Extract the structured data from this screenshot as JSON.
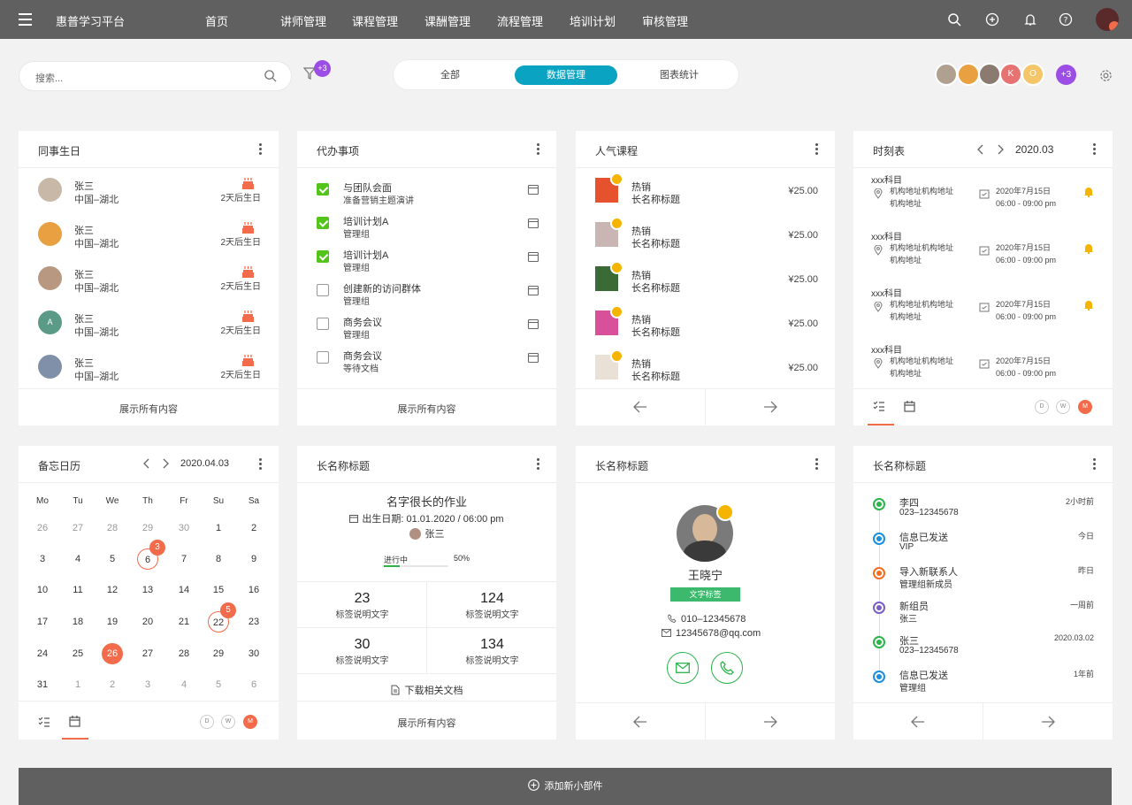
{
  "topbar": {
    "brand": "惠普学习平台",
    "nav": [
      "首页",
      "讲师管理",
      "课程管理",
      "课酬管理",
      "流程管理",
      "培训计划",
      "审核管理"
    ]
  },
  "toolbar": {
    "search_placeholder": "搜索...",
    "filter_badge": "+3",
    "tabs": [
      "全部",
      "数据管理",
      "图表统计"
    ],
    "active_tab": "数据管理",
    "avatars": [
      "K",
      "O"
    ],
    "avatars_more": "+3"
  },
  "birthdays": {
    "title": "同事生日",
    "items": [
      {
        "name": "张三",
        "region": "中国–湖北",
        "note": "2天后生日"
      },
      {
        "name": "张三",
        "region": "中国–湖北",
        "note": "2天后生日"
      },
      {
        "name": "张三",
        "region": "中国–湖北",
        "note": "2天后生日"
      },
      {
        "name": "张三",
        "region": "中国–湖北",
        "note": "2天后生日",
        "initial": "A"
      },
      {
        "name": "张三",
        "region": "中国–湖北",
        "note": "2天后生日"
      }
    ],
    "footer": "展示所有内容"
  },
  "todos": {
    "title": "代办事项",
    "items": [
      {
        "title": "与团队会面",
        "sub": "准备营销主题演讲",
        "checked": true,
        "icon": "calendar-check-icon"
      },
      {
        "title": "培训计划A",
        "sub": "管理组",
        "checked": true,
        "icon": "plane-icon"
      },
      {
        "title": "培训计划A",
        "sub": "管理组",
        "checked": true,
        "icon": "ticket-icon"
      },
      {
        "title": "创建新的访问群体",
        "sub": "管理组",
        "checked": false,
        "icon": "megaphone-icon"
      },
      {
        "title": "商务会议",
        "sub": "管理组",
        "checked": false,
        "icon": "briefcase-icon"
      },
      {
        "title": "商务会议",
        "sub": "等待文档",
        "checked": false,
        "icon": "coins-icon"
      }
    ],
    "footer": "展示所有内容"
  },
  "courses": {
    "title": "人气课程",
    "items": [
      {
        "tag": "热销",
        "name": "长名称标题",
        "price": "¥25.00"
      },
      {
        "tag": "热销",
        "name": "长名称标题",
        "price": "¥25.00"
      },
      {
        "tag": "热销",
        "name": "长名称标题",
        "price": "¥25.00"
      },
      {
        "tag": "热销",
        "name": "长名称标题",
        "price": "¥25.00"
      },
      {
        "tag": "热销",
        "name": "长名称标题",
        "price": "¥25.00"
      }
    ]
  },
  "schedule": {
    "title": "时刻表",
    "date": "2020.03",
    "items": [
      {
        "subject": "xxx科目",
        "addr1": "机构地址机构地址",
        "addr2": "机构地址",
        "date": "2020年7月15日",
        "time": "06:00 - 09:00 pm",
        "bell": true
      },
      {
        "subject": "xxx科目",
        "addr1": "机构地址机构地址",
        "addr2": "机构地址",
        "date": "2020年7月15日",
        "time": "06:00 - 09:00 pm",
        "bell": true
      },
      {
        "subject": "xxx科目",
        "addr1": "机构地址机构地址",
        "addr2": "机构地址",
        "date": "2020年7月15日",
        "time": "06:00 - 09:00 pm",
        "bell": true
      },
      {
        "subject": "xxx科目",
        "addr1": "机构地址机构地址",
        "addr2": "机构地址",
        "date": "2020年7月15日",
        "time": "06:00 - 09:00 pm",
        "bell": false
      }
    ],
    "views": [
      "D",
      "W",
      "M"
    ],
    "active_view": "M"
  },
  "calendar": {
    "title": "备忘日历",
    "date": "2020.04.03",
    "weekdays": [
      "Mo",
      "Tu",
      "We",
      "Th",
      "Fr",
      "Su",
      "Sa"
    ],
    "weeks": [
      [
        "26",
        "27",
        "28",
        "29",
        "30",
        "1",
        "2"
      ],
      [
        "3",
        "4",
        "5",
        "6",
        "7",
        "8",
        "9"
      ],
      [
        "10",
        "11",
        "12",
        "13",
        "14",
        "15",
        "16"
      ],
      [
        "17",
        "18",
        "19",
        "20",
        "21",
        "22",
        "23"
      ],
      [
        "24",
        "25",
        "26",
        "27",
        "28",
        "29",
        "30"
      ],
      [
        "31",
        "1",
        "2",
        "3",
        "4",
        "5",
        "6"
      ]
    ],
    "badges": [
      {
        "label": "3",
        "week": 1,
        "day": 3
      },
      {
        "label": "5",
        "week": 3,
        "day": 5
      }
    ],
    "views": [
      "D",
      "W",
      "M"
    ],
    "active_view": "M"
  },
  "homework": {
    "title": "长名称标题",
    "name": "名字很长的作业",
    "due": "出生日期: 01.01.2020 / 06:00 pm",
    "owner": "张三",
    "status": "进行中",
    "progress_percent": 50,
    "progress_label": "50%",
    "stats": [
      {
        "value": "23",
        "label": "标签说明文字"
      },
      {
        "value": "124",
        "label": "标签说明文字"
      },
      {
        "value": "30",
        "label": "标签说明文字"
      },
      {
        "value": "134",
        "label": "标签说明文字"
      }
    ],
    "download": "下载相关文档",
    "footer": "展示所有内容"
  },
  "profile": {
    "title": "长名称标题",
    "name": "王晓宁",
    "tag": "文字标签",
    "phone": "010–12345678",
    "email": "12345678@qq.com"
  },
  "timeline": {
    "title": "长名称标题",
    "items": [
      {
        "t1": "李四",
        "t2": "023–12345678",
        "time": "2小时前",
        "color": "#2bb44a"
      },
      {
        "t1": "信息已发送",
        "t2": "VIP",
        "time": "今日",
        "color": "#1a8fe0"
      },
      {
        "t1": "导入新联系人",
        "t2": "管理组新成员",
        "time": "昨日",
        "color": "#f26b1e"
      },
      {
        "t1": "新组员",
        "t2": "张三",
        "time": "一周前",
        "color": "#7b5ec7"
      },
      {
        "t1": "张三",
        "t2": "023–12345678",
        "time": "2020.03.02",
        "color": "#2bb44a"
      },
      {
        "t1": "信息已发送",
        "t2": "管理组",
        "time": "1年前",
        "color": "#1a8fe0"
      }
    ]
  },
  "add_widget": "添加新小部件",
  "colors": {
    "accent": "#0aa3c2",
    "orange": "#f26b4a",
    "green": "#52c41a",
    "purple": "#9b4de6"
  }
}
